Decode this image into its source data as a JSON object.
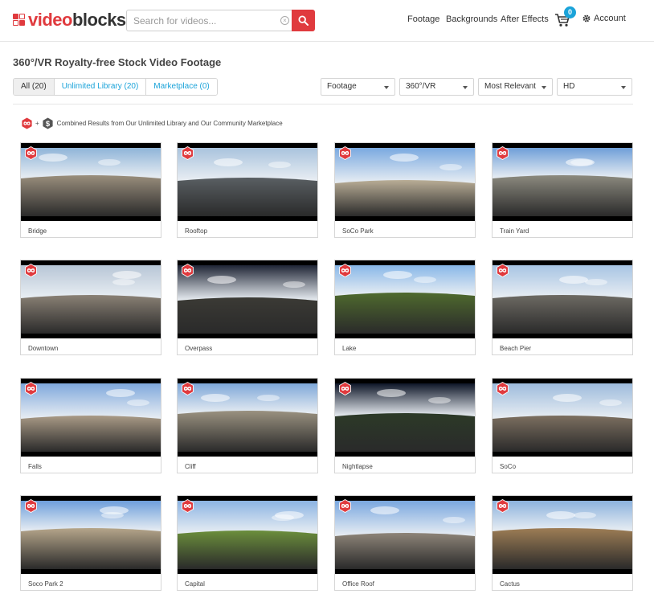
{
  "header": {
    "logo_v": "video",
    "logo_b": "blocks",
    "search": {
      "placeholder": "Search for videos...",
      "value": ""
    },
    "nav": {
      "footage": "Footage",
      "backgrounds": "Backgrounds",
      "after_effects": "After Effects"
    },
    "cart_count": "0",
    "account": "Account"
  },
  "page": {
    "title": "360°/VR Royalty-free Stock Video Footage"
  },
  "tabs": [
    {
      "label": "All (20)",
      "active": true
    },
    {
      "label": "Unlimited Library (20)",
      "active": false
    },
    {
      "label": "Marketplace (0)",
      "active": false
    }
  ],
  "filters": {
    "category": "Footage",
    "format": "360°/VR",
    "sort": "Most Relevant",
    "resolution": "HD"
  },
  "combined_text": "Combined Results from Our Unlimited Library and Our Community Marketplace",
  "colors": {
    "brand_red": "#e03a3e",
    "link_blue": "#1aa3d9",
    "badge_dark": "#555555"
  },
  "icons": {
    "unlimited_badge": "infinity-hexagon-icon",
    "marketplace_badge": "dollar-hexagon-icon",
    "cart": "cart-icon",
    "account": "gear-icon",
    "search": "magnifier-icon"
  },
  "videos": [
    {
      "label": "Bridge",
      "sky": "#8fb4d8",
      "ground": "#9a8f7d"
    },
    {
      "label": "Rooftop",
      "sky": "#a9c3dd",
      "ground": "#5a5f63"
    },
    {
      "label": "SoCo Park",
      "sky": "#7aa9e0",
      "ground": "#b9ad96"
    },
    {
      "label": "Train Yard",
      "sky": "#6f9fd8",
      "ground": "#8c8a7f"
    },
    {
      "label": "Downtown",
      "sky": "#b7c6d6",
      "ground": "#8a8175"
    },
    {
      "label": "Overpass",
      "sky": "#1f2535",
      "ground": "#3b3a35"
    },
    {
      "label": "Lake",
      "sky": "#88b7e8",
      "ground": "#4f6a2e"
    },
    {
      "label": "Beach Pier",
      "sky": "#a7c4e3",
      "ground": "#6d6a63"
    },
    {
      "label": "Falls",
      "sky": "#7fa8dc",
      "ground": "#a99a86"
    },
    {
      "label": "Cliff",
      "sky": "#7ea7d8",
      "ground": "#9a9180"
    },
    {
      "label": "Nightlapse",
      "sky": "#0d1526",
      "ground": "#2c3a28"
    },
    {
      "label": "SoCo",
      "sky": "#9dbbdc",
      "ground": "#7c6f60"
    },
    {
      "label": "Soco Park 2",
      "sky": "#6e9fdb",
      "ground": "#b5a58a"
    },
    {
      "label": "Capital",
      "sky": "#8cb4e3",
      "ground": "#6b8e3c"
    },
    {
      "label": "Office Roof",
      "sky": "#7aa7df",
      "ground": "#8d8478"
    },
    {
      "label": "Cactus",
      "sky": "#8cb2dd",
      "ground": "#9d7d55"
    }
  ]
}
